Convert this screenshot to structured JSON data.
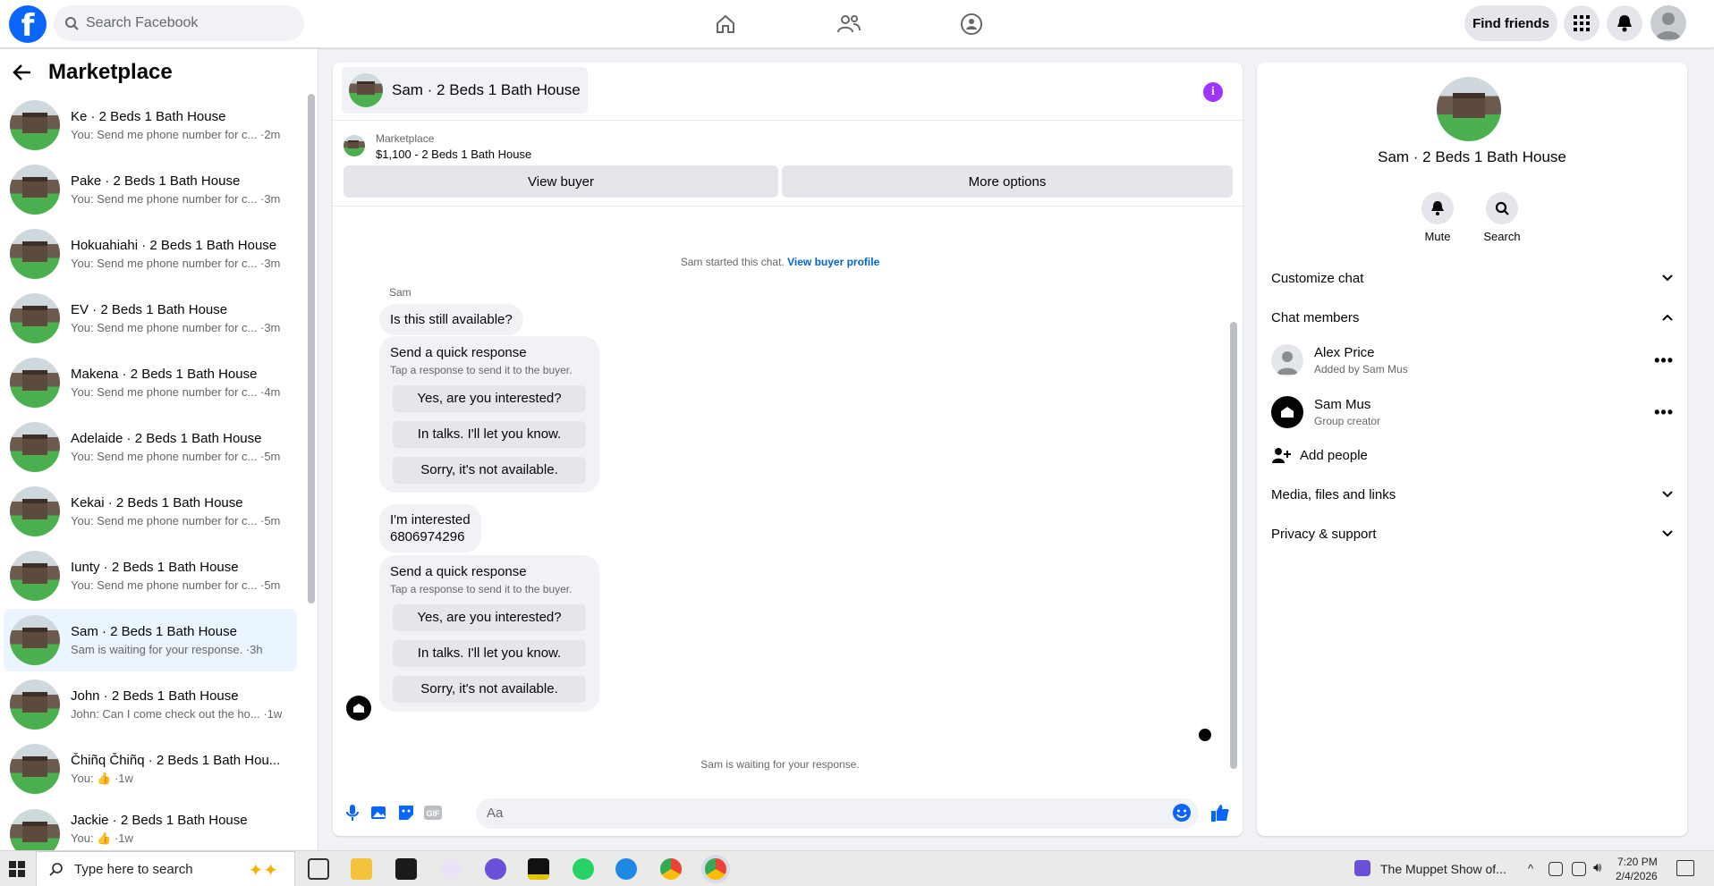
{
  "header": {
    "search_placeholder": "Search Facebook",
    "find_friends": "Find friends"
  },
  "sidebar": {
    "title": "Marketplace",
    "threads": [
      {
        "name": "Ke · 2 Beds 1 Bath House",
        "preview": "You: Send me phone number for c... ·2m"
      },
      {
        "name": "Pake · 2 Beds 1 Bath House",
        "preview": "You: Send me phone number for c... ·3m"
      },
      {
        "name": "Hokuahiahi · 2 Beds 1 Bath House",
        "preview": "You: Send me phone number for c... ·3m"
      },
      {
        "name": "EV · 2 Beds 1 Bath House",
        "preview": "You: Send me phone number for c... ·3m"
      },
      {
        "name": "Makena · 2 Beds 1 Bath House",
        "preview": "You: Send me phone number for c... ·4m"
      },
      {
        "name": "Adelaide · 2 Beds 1 Bath House",
        "preview": "You: Send me phone number for c... ·5m"
      },
      {
        "name": "Kekai · 2 Beds 1 Bath House",
        "preview": "You: Send me phone number for c... ·5m"
      },
      {
        "name": "Iunty · 2 Beds 1 Bath House",
        "preview": "You: Send me phone number for c... ·5m"
      },
      {
        "name": "Sam · 2 Beds 1 Bath House",
        "preview": "Sam is waiting for your response. ·3h"
      },
      {
        "name": "John · 2 Beds 1 Bath House",
        "preview": "John: Can I come check out the ho... ·1w"
      },
      {
        "name": "Čhiñq Čhiñq · 2 Beds 1 Bath Hou...",
        "preview": "You: 👍 ·1w"
      },
      {
        "name": "Jackie · 2 Beds 1 Bath House",
        "preview": "You: 👍 ·1w"
      }
    ]
  },
  "chat": {
    "title": "Sam · 2 Beds 1 Bath House",
    "marketplace_label": "Marketplace",
    "listing": "$1,100 - 2 Beds 1 Bath House",
    "view_buyer": "View buyer",
    "more_options": "More options",
    "started_text": "Sam started this chat.",
    "view_profile": "View buyer profile",
    "sender_name": "Sam",
    "msg1": "Is this still available?",
    "quick_title": "Send a quick response",
    "quick_sub": "Tap a response to send it to the buyer.",
    "quick_options": [
      "Yes, are you interested?",
      "In talks. I'll let you know.",
      "Sorry, it's not available."
    ],
    "msg2_line1": "I'm interested",
    "msg2_line2": "6806974296",
    "waiting": "Sam is waiting for your response.",
    "composer_placeholder": "Aa"
  },
  "details": {
    "title": "Sam · 2 Beds 1 Bath House",
    "mute": "Mute",
    "search": "Search",
    "customize": "Customize chat",
    "chat_members": "Chat members",
    "members": [
      {
        "name": "Alex Price",
        "sub": "Added by Sam Mus"
      },
      {
        "name": "Sam Mus",
        "sub": "Group creator"
      }
    ],
    "add_people": "Add people",
    "media": "Media, files and links",
    "privacy": "Privacy & support"
  },
  "taskbar": {
    "search_placeholder": "Type here to search",
    "media_title": "The Muppet Show of...",
    "time": "7:20 PM",
    "date": "2/4/2026"
  },
  "colors": {
    "brand": "#0866ff",
    "accent_purple": "#a033ff",
    "link": "#0064d1"
  }
}
